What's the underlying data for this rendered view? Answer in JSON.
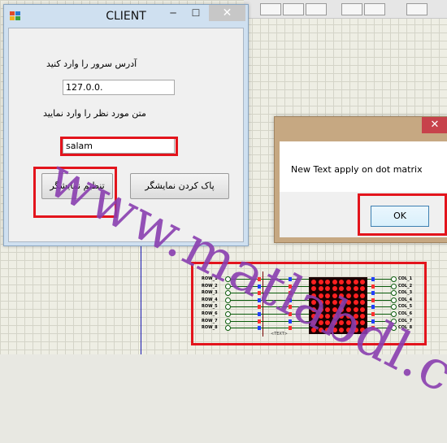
{
  "client_window": {
    "title": "CLIENT",
    "minimize_glyph": "─",
    "maximize_glyph": "☐",
    "close_glyph": "✕",
    "server_address_label": "آدرس سرور را وارد کنید",
    "server_address_value": "127.0.0.",
    "text_label": "متن مورد نظر را وارد نمایید",
    "text_value": "salam",
    "set_display_button": "تنظیم نمایشگر",
    "clear_display_button": "پاک کردن نمایشگر"
  },
  "dialog": {
    "close_glyph": "✕",
    "message": "New Text apply on dot matrix",
    "ok_button": "OK"
  },
  "watermark": "www.matlabdl.com",
  "circuit": {
    "row_labels": [
      "ROW_1",
      "ROW_2",
      "ROW_3",
      "ROW_4",
      "ROW_5",
      "ROW_6",
      "ROW_7",
      "ROW_8"
    ],
    "col_labels": [
      "COL_1",
      "COL_2",
      "COL_3",
      "COL_4",
      "COL_5",
      "COL_6",
      "COL_7",
      "COL_8"
    ],
    "chip_label": "<TEXT>"
  },
  "colors": {
    "highlight_red": "#e3141c",
    "watermark_purple": "#8a3fb0",
    "led_red": "#ff2020"
  }
}
